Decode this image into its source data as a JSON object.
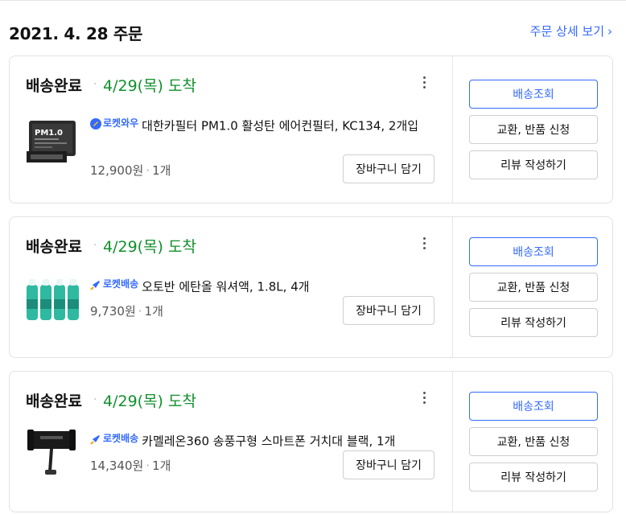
{
  "header": {
    "order_date": "2021. 4. 28 주문",
    "detail_link": "주문 상세 보기",
    "chevron": "›"
  },
  "orders": [
    {
      "status": "배송완료",
      "dot": "·",
      "eta": "4/29(목) 도착",
      "badge": {
        "label": "로켓와우",
        "icon": "rocket-wow-icon"
      },
      "product_name": "대한카필터 PM1.0 활성탄 에어컨필터, KC134, 2개입",
      "price": "12,900원",
      "qty": "1개",
      "cart_button": "장바구니 담기",
      "actions": {
        "track": "배송조회",
        "exchange": "교환, 반품 신청",
        "review": "리뷰 작성하기"
      },
      "thumb": "car-filter-thumbnail"
    },
    {
      "status": "배송완료",
      "dot": "·",
      "eta": "4/29(목) 도착",
      "badge": {
        "label": "로켓배송",
        "icon": "rocket-icon"
      },
      "product_name": "오토반 에탄올 워셔액, 1.8L, 4개",
      "price": "9,730원",
      "qty": "1개",
      "cart_button": "장바구니 담기",
      "actions": {
        "track": "배송조회",
        "exchange": "교환, 반품 신청",
        "review": "리뷰 작성하기"
      },
      "thumb": "washer-fluid-thumbnail"
    },
    {
      "status": "배송완료",
      "dot": "·",
      "eta": "4/29(목) 도착",
      "badge": {
        "label": "로켓배송",
        "icon": "rocket-icon"
      },
      "product_name": "카멜레온360 송풍구형 스마트폰 거치대 블랙, 1개",
      "price": "14,340원",
      "qty": "1개",
      "cart_button": "장바구니 담기",
      "actions": {
        "track": "배송조회",
        "exchange": "교환, 반품 신청",
        "review": "리뷰 작성하기"
      },
      "thumb": "phone-holder-thumbnail"
    }
  ],
  "colors": {
    "accent": "#346aff",
    "arrival": "#11902c",
    "text": "#111111",
    "muted": "#555555"
  }
}
